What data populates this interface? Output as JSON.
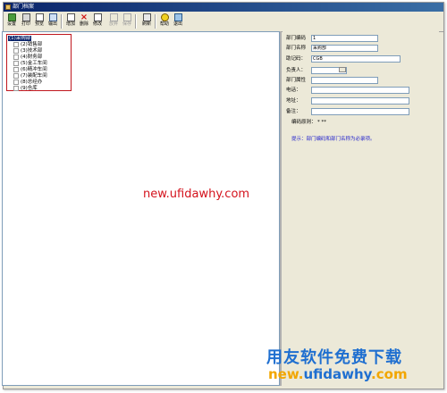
{
  "window": {
    "title": "部门档案"
  },
  "toolbar": {
    "buttons": [
      {
        "label": "设置",
        "icon": "setup-icon"
      },
      {
        "label": "打印",
        "icon": "print-icon"
      },
      {
        "label": "预览",
        "icon": "preview-icon"
      },
      {
        "label": "输出",
        "icon": "export-icon"
      },
      {
        "label": "增加",
        "icon": "add-icon"
      },
      {
        "label": "删除",
        "icon": "delete-icon"
      },
      {
        "label": "修改",
        "icon": "edit-icon"
      },
      {
        "label": "放弃",
        "icon": "undo-icon"
      },
      {
        "label": "保存",
        "icon": "save-icon"
      },
      {
        "label": "刷新",
        "icon": "refresh-icon"
      },
      {
        "label": "帮助",
        "icon": "help-icon"
      },
      {
        "label": "退出",
        "icon": "exit-icon"
      }
    ]
  },
  "tree": {
    "root": "(1)采购部",
    "items": [
      "(2)销售部",
      "(3)技术部",
      "(4)财务部",
      "(5)金工车间",
      "(6)精冲车间",
      "(7)装配车间",
      "(8)总经办",
      "(9)仓库"
    ]
  },
  "form": {
    "dept_code_label": "部门编码",
    "dept_code_value": "1",
    "dept_name_label": "部门名称",
    "dept_name_value": "采购部",
    "mnemonic_label": "助记码：",
    "mnemonic_value": "CGB",
    "manager_label": "负责人：",
    "manager_value": "",
    "attribute_label": "部门属性",
    "phone_label": "电话：",
    "address_label": "地址：",
    "remark_label": "备注：",
    "code_rule_label": "编码原则：",
    "code_rule_value": "*  **",
    "hint": "提示：部门编码和部门名称为必录项。"
  },
  "watermark": {
    "center": "new.ufidawhy.com",
    "brand": "用友软件免费下载",
    "url_a": "new.",
    "url_b": "ufidawhy",
    "url_c": ".com"
  }
}
